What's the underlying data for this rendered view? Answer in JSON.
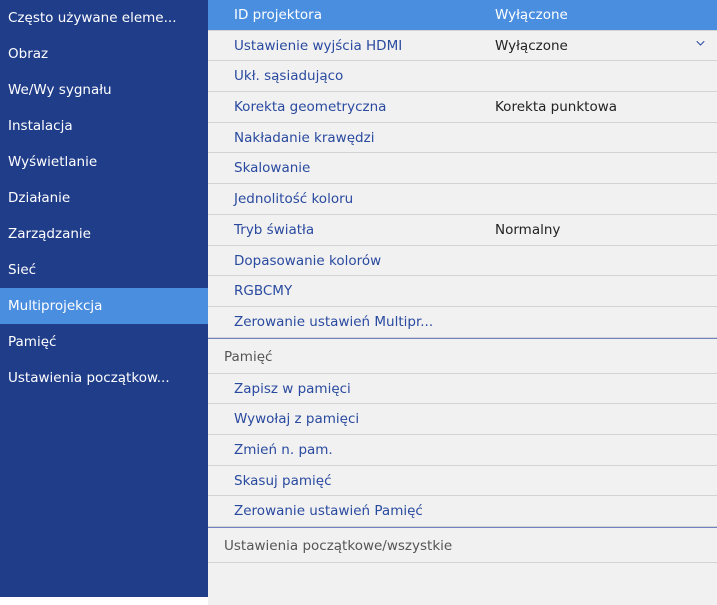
{
  "sidebar": {
    "items": [
      {
        "label": "Często używane eleme..."
      },
      {
        "label": "Obraz"
      },
      {
        "label": "We/Wy sygnału"
      },
      {
        "label": "Instalacja"
      },
      {
        "label": "Wyświetlanie"
      },
      {
        "label": "Działanie"
      },
      {
        "label": "Zarządzanie"
      },
      {
        "label": "Sieć"
      },
      {
        "label": "Multiprojekcja"
      },
      {
        "label": "Pamięć"
      },
      {
        "label": "Ustawienia początkow..."
      }
    ],
    "active_index": 8
  },
  "multiprojection": {
    "rows": [
      {
        "label": "ID projektora",
        "value": "Wyłączone"
      },
      {
        "label": "Ustawienie wyjścia HDMI",
        "value": "Wyłączone"
      },
      {
        "label": "Ukł. sąsiadująco",
        "value": ""
      },
      {
        "label": "Korekta geometryczna",
        "value": "Korekta punktowa"
      },
      {
        "label": "Nakładanie krawędzi",
        "value": ""
      },
      {
        "label": "Skalowanie",
        "value": ""
      },
      {
        "label": "Jednolitość koloru",
        "value": ""
      },
      {
        "label": "Tryb światła",
        "value": "Normalny"
      },
      {
        "label": "Dopasowanie kolorów",
        "value": ""
      },
      {
        "label": "RGBCMY",
        "value": ""
      },
      {
        "label": "Zerowanie ustawień Multipr...",
        "value": ""
      }
    ]
  },
  "memory": {
    "header": "Pamięć",
    "rows": [
      {
        "label": "Zapisz w pamięci"
      },
      {
        "label": "Wywołaj z pamięci"
      },
      {
        "label": "Zmień n. pam."
      },
      {
        "label": "Skasuj pamięć"
      },
      {
        "label": "Zerowanie ustawień Pamięć"
      }
    ]
  },
  "initial": {
    "header": "Ustawienia początkowe/wszystkie"
  },
  "icons": {
    "hdmi_dropdown": "chevron-down-icon"
  },
  "colors": {
    "sidebar_bg": "#203d8a",
    "highlight": "#4a8ee0",
    "link_text": "#2a4aa0",
    "panel_bg": "#f1f1f1"
  }
}
